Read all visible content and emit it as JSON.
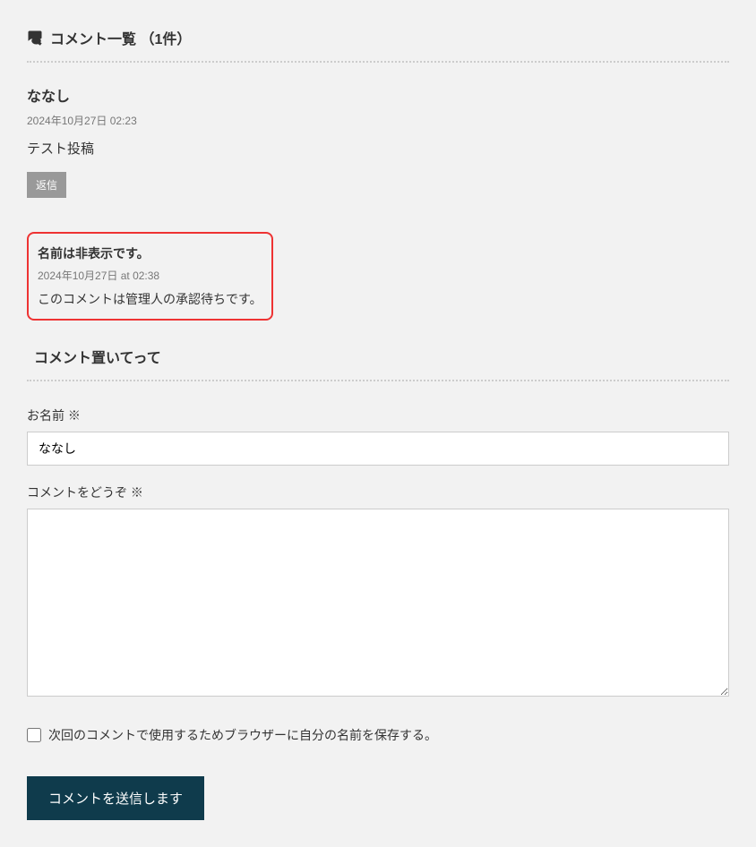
{
  "commentList": {
    "heading": "コメント一覧 （1件）"
  },
  "comment1": {
    "author": "ななし",
    "date": "2024年10月27日 02:23",
    "body": "テスト投稿",
    "replyLabel": "返信"
  },
  "pendingComment": {
    "author": "名前は非表示です。",
    "date": "2024年10月27日 at 02:38",
    "body": "このコメントは管理人の承認待ちです。"
  },
  "formSection": {
    "heading": "コメント置いてって"
  },
  "form": {
    "nameLabel": "お名前 ※",
    "nameValue": "ななし",
    "commentLabel": "コメントをどうぞ ※",
    "commentValue": "",
    "saveNameLabel": "次回のコメントで使用するためブラウザーに自分の名前を保存する。",
    "submitLabel": "コメントを送信します"
  }
}
